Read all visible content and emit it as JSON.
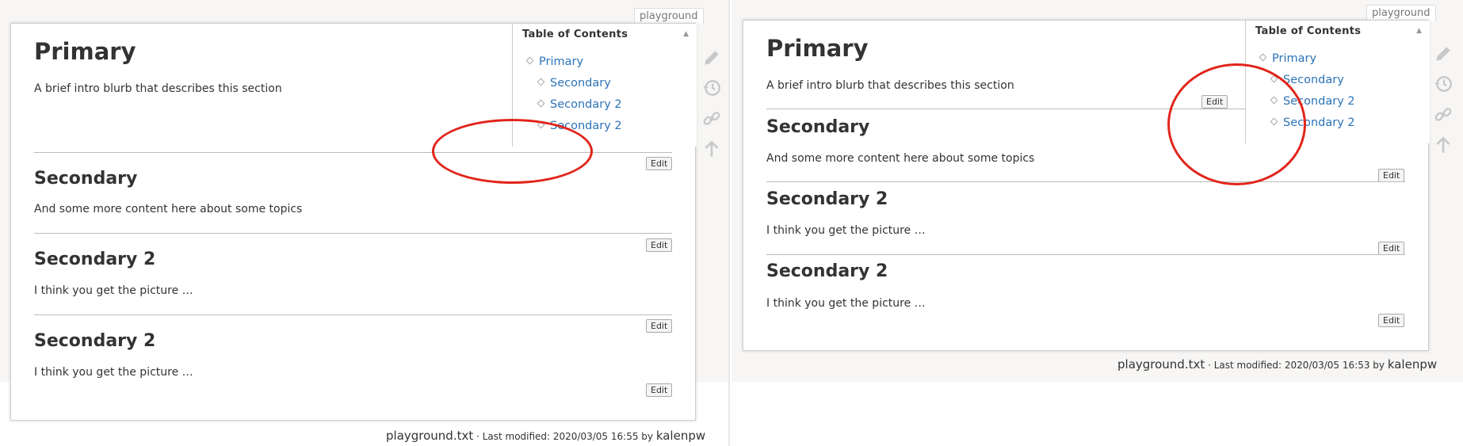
{
  "panels": {
    "left": {
      "tab_label": "playground",
      "title": "Primary",
      "intro": "A brief intro blurb that describes this section",
      "sections": [
        {
          "heading": "Secondary",
          "text": "And some more content here about some topics"
        },
        {
          "heading": "Secondary 2",
          "text": "I think you get the picture …"
        },
        {
          "heading": "Secondary 2",
          "text": "I think you get the picture …"
        }
      ],
      "edit_label": "Edit",
      "footer": {
        "file": "playground.txt",
        "modified": " · Last modified: 2020/03/05 16:55 by ",
        "user": "kalenpw"
      }
    },
    "right": {
      "tab_label": "playground",
      "title": "Primary",
      "intro": "A brief intro blurb that describes this section",
      "sections": [
        {
          "heading": "Secondary",
          "text": "And some more content here about some topics"
        },
        {
          "heading": "Secondary 2",
          "text": "I think you get the picture …"
        },
        {
          "heading": "Secondary 2",
          "text": "I think you get the picture …"
        }
      ],
      "edit_label": "Edit",
      "footer": {
        "file": "playground.txt",
        "modified": " · Last modified: 2020/03/05 16:53 by ",
        "user": "kalenpw"
      }
    }
  },
  "toc": {
    "title": "Table of Contents",
    "toggle": "▲",
    "items": [
      "Primary",
      "Secondary",
      "Secondary 2",
      "Secondary 2"
    ]
  },
  "tools": [
    "pencil-icon",
    "history-icon",
    "link-icon",
    "arrow-up-icon"
  ],
  "colors": {
    "link": "#2b73b7",
    "annotation": "#e1251b",
    "icon": "#c8c8c8"
  }
}
